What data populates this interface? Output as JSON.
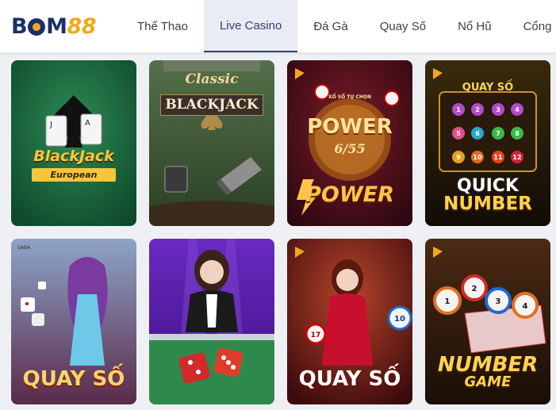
{
  "brand": {
    "logo_text_left": "B",
    "logo_text_mid": "M",
    "logo_text_right": "88"
  },
  "nav": {
    "items": [
      {
        "label": "Thể Thao",
        "active": false
      },
      {
        "label": "Live Casino",
        "active": true
      },
      {
        "label": "Đá Gà",
        "active": false
      },
      {
        "label": "Quay Số",
        "active": false
      },
      {
        "label": "Nổ Hũ",
        "active": false
      },
      {
        "label": "Cổng",
        "active": false
      }
    ]
  },
  "games": [
    {
      "title": "BlackJack",
      "subtitle": "European"
    },
    {
      "title": "Classic",
      "subtitle": "BLACKJACK"
    },
    {
      "title": "POWER",
      "subtitle": "6/55",
      "banner": "XỔ SỐ TỰ CHỌN",
      "footer": "POWER"
    },
    {
      "title": "QUICK",
      "subtitle": "NUMBER",
      "banner": "QUAY SỐ"
    },
    {
      "title": "QUAY SỐ",
      "tag": "SABA"
    },
    {
      "title": ""
    },
    {
      "title": "QUAY SỐ"
    },
    {
      "title": "NUMBER",
      "subtitle": "GAME"
    }
  ],
  "colors": {
    "brand_navy": "#1c2f6b",
    "brand_gold": "#f2a81d",
    "nav_active_bg": "#e9ecf2"
  }
}
